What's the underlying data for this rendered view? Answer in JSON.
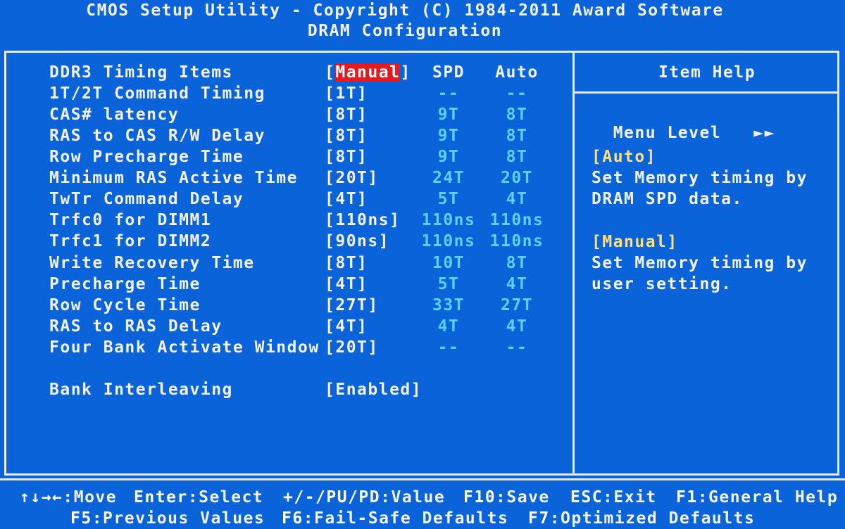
{
  "header": {
    "title": "CMOS Setup Utility - Copyright (C) 1984-2011 Award Software",
    "subtitle": "DRAM Configuration"
  },
  "table": {
    "col_spd": "SPD",
    "col_auto": "Auto",
    "rows": [
      {
        "label": "DDR3 Timing Items",
        "value": "Manual",
        "spd": "",
        "auto": ""
      },
      {
        "label": "1T/2T Command Timing",
        "value": "[1T]",
        "spd": "--",
        "auto": "--"
      },
      {
        "label": "CAS# latency",
        "value": "[8T]",
        "spd": "9T",
        "auto": "8T"
      },
      {
        "label": "RAS to CAS R/W Delay",
        "value": "[8T]",
        "spd": "9T",
        "auto": "8T"
      },
      {
        "label": "Row Precharge Time",
        "value": "[8T]",
        "spd": "9T",
        "auto": "8T"
      },
      {
        "label": "Minimum RAS Active Time",
        "value": "[20T]",
        "spd": "24T",
        "auto": "20T"
      },
      {
        "label": "TwTr Command Delay",
        "value": "[4T]",
        "spd": "5T",
        "auto": "4T"
      },
      {
        "label": "Trfc0 for DIMM1",
        "value": "[110ns]",
        "spd": "110ns",
        "auto": "110ns"
      },
      {
        "label": "Trfc1 for DIMM2",
        "value": "[90ns]",
        "spd": "110ns",
        "auto": "110ns"
      },
      {
        "label": "Write Recovery Time",
        "value": "[8T]",
        "spd": "10T",
        "auto": "8T"
      },
      {
        "label": "Precharge Time",
        "value": "[4T]",
        "spd": "5T",
        "auto": "4T"
      },
      {
        "label": "Row Cycle Time",
        "value": "[27T]",
        "spd": "33T",
        "auto": "27T"
      },
      {
        "label": "RAS to RAS Delay",
        "value": "[4T]",
        "spd": "4T",
        "auto": "4T"
      },
      {
        "label": "Four Bank Activate Window",
        "value": "[20T]",
        "spd": "--",
        "auto": "--"
      }
    ],
    "bank": {
      "label": "Bank Interleaving",
      "value": "[Enabled]"
    }
  },
  "help": {
    "title": "Item Help",
    "menu_level": "Menu Level",
    "menu_arrows": "►►",
    "auto_title": "[Auto]",
    "auto_line1": "Set Memory timing by",
    "auto_line2": "DRAM SPD data.",
    "manual_title": "[Manual]",
    "manual_line1": "Set Memory timing by",
    "manual_line2": "user setting."
  },
  "footer": {
    "line1": [
      {
        "key": "↑↓→←",
        "action": ":Move"
      },
      {
        "key": "Enter",
        "action": ":Select"
      },
      {
        "key": "+/-/PU/PD",
        "action": ":Value"
      },
      {
        "key": "F10",
        "action": ":Save"
      },
      {
        "key": "ESC",
        "action": ":Exit"
      },
      {
        "key": "F1",
        "action": ":General Help"
      }
    ],
    "line2": [
      {
        "key": "F5",
        "action": ":Previous Values"
      },
      {
        "key": "F6",
        "action": ":Fail-Safe Defaults"
      },
      {
        "key": "F7",
        "action": ":Optimized Defaults"
      }
    ]
  }
}
